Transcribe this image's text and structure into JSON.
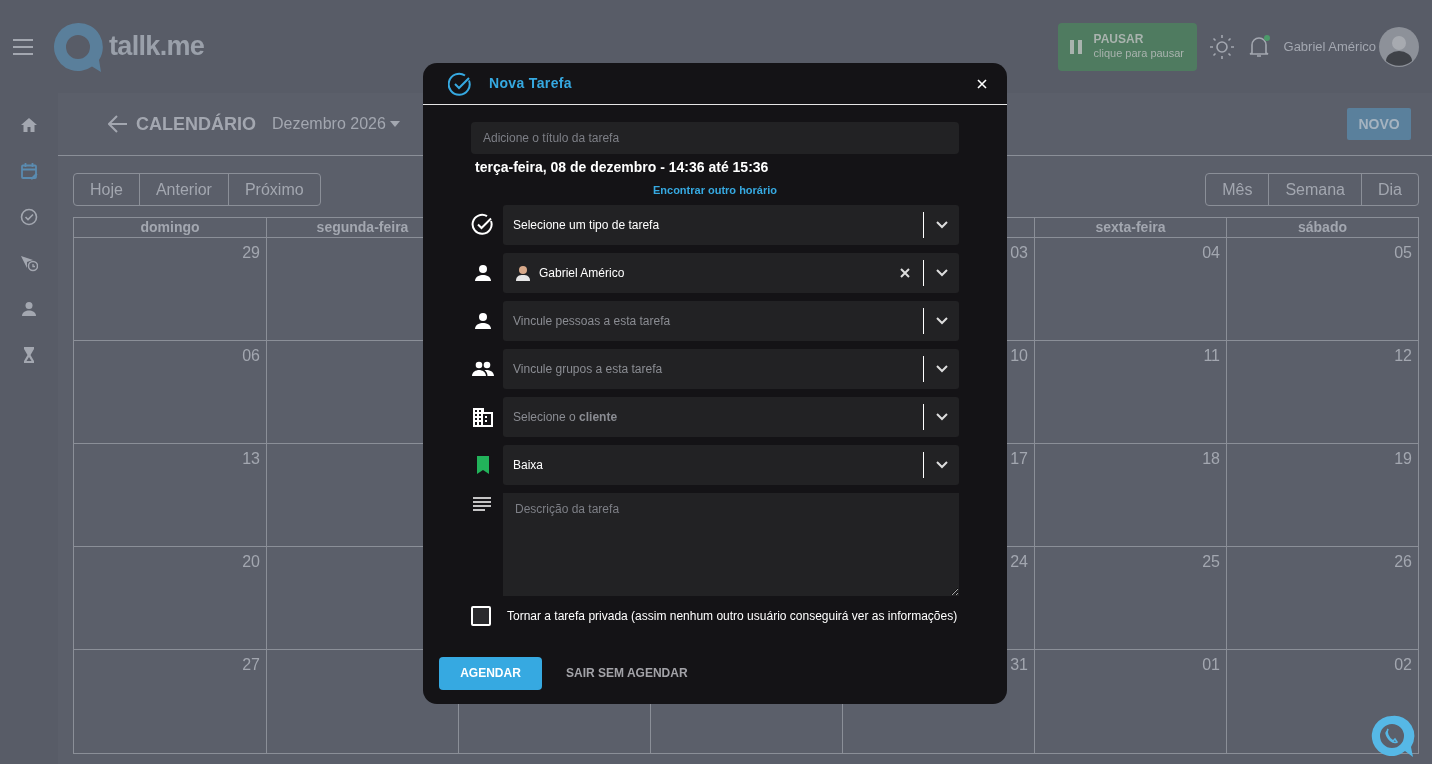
{
  "topbar": {
    "brand": "tallk.me",
    "pause": {
      "title": "PAUSAR",
      "subtitle": "clique para pausar"
    },
    "user_name": "Gabriel Américo"
  },
  "sidebar": {
    "items": [
      {
        "kind": "home",
        "selected": false
      },
      {
        "kind": "calendar",
        "selected": true
      },
      {
        "kind": "check",
        "selected": false
      },
      {
        "kind": "scheduled",
        "selected": false
      },
      {
        "kind": "person",
        "selected": false
      },
      {
        "kind": "hourglass",
        "selected": false
      }
    ]
  },
  "calendar_header": {
    "title": "CALENDÁRIO",
    "month": "Dezembro 2026",
    "new_button": "NOVO"
  },
  "nav_buttons": [
    "Hoje",
    "Anterior",
    "Próximo"
  ],
  "view_buttons": [
    "Mês",
    "Semana",
    "Dia"
  ],
  "calendar": {
    "weekdays": {
      "sunday": "domingo",
      "monday": "segunda-feira",
      "friday": "sexta-feira",
      "saturday": "sábado"
    },
    "weeks": [
      {
        "sunday": "29",
        "thursday": "03",
        "friday": "04",
        "saturday": "05"
      },
      {
        "sunday": "06",
        "thursday": "10",
        "friday": "11",
        "saturday": "12"
      },
      {
        "sunday": "13",
        "thursday": "17",
        "friday": "18",
        "saturday": "19"
      },
      {
        "sunday": "20",
        "thursday": "24",
        "friday": "25",
        "saturday": "26"
      },
      {
        "sunday": "27",
        "thursday": "31",
        "friday": "01",
        "saturday": "02"
      }
    ]
  },
  "modal": {
    "title": "Nova Tarefa",
    "title_placeholder": "Adicione o título da tarefa",
    "date_text": "terça-feira, 08 de dezembro - 14:36 até 15:36",
    "find_link": "Encontrar outro horário",
    "fields": [
      {
        "kind": "task_type",
        "value": "Selecione um tipo de tarefa",
        "clearable": false
      },
      {
        "kind": "owner",
        "value": "Gabriel Américo",
        "clearable": true
      },
      {
        "kind": "people",
        "placeholder": "Vincule pessoas a esta tarefa",
        "clearable": false
      },
      {
        "kind": "groups",
        "placeholder": "Vincule grupos a esta tarefa",
        "clearable": false
      },
      {
        "kind": "client",
        "placeholder": "Selecione o **cliente**",
        "clearable": false
      },
      {
        "kind": "priority",
        "value": "Baixa",
        "clearable": false
      }
    ],
    "description_placeholder": "Descrição da tarefa",
    "private": {
      "label": "Tornar a tarefa privada (assim nenhum outro usuário conseguirá ver as informações)",
      "checked": false
    },
    "primary_button": "AGENDAR",
    "secondary_button": "SAIR SEM AGENDAR"
  }
}
